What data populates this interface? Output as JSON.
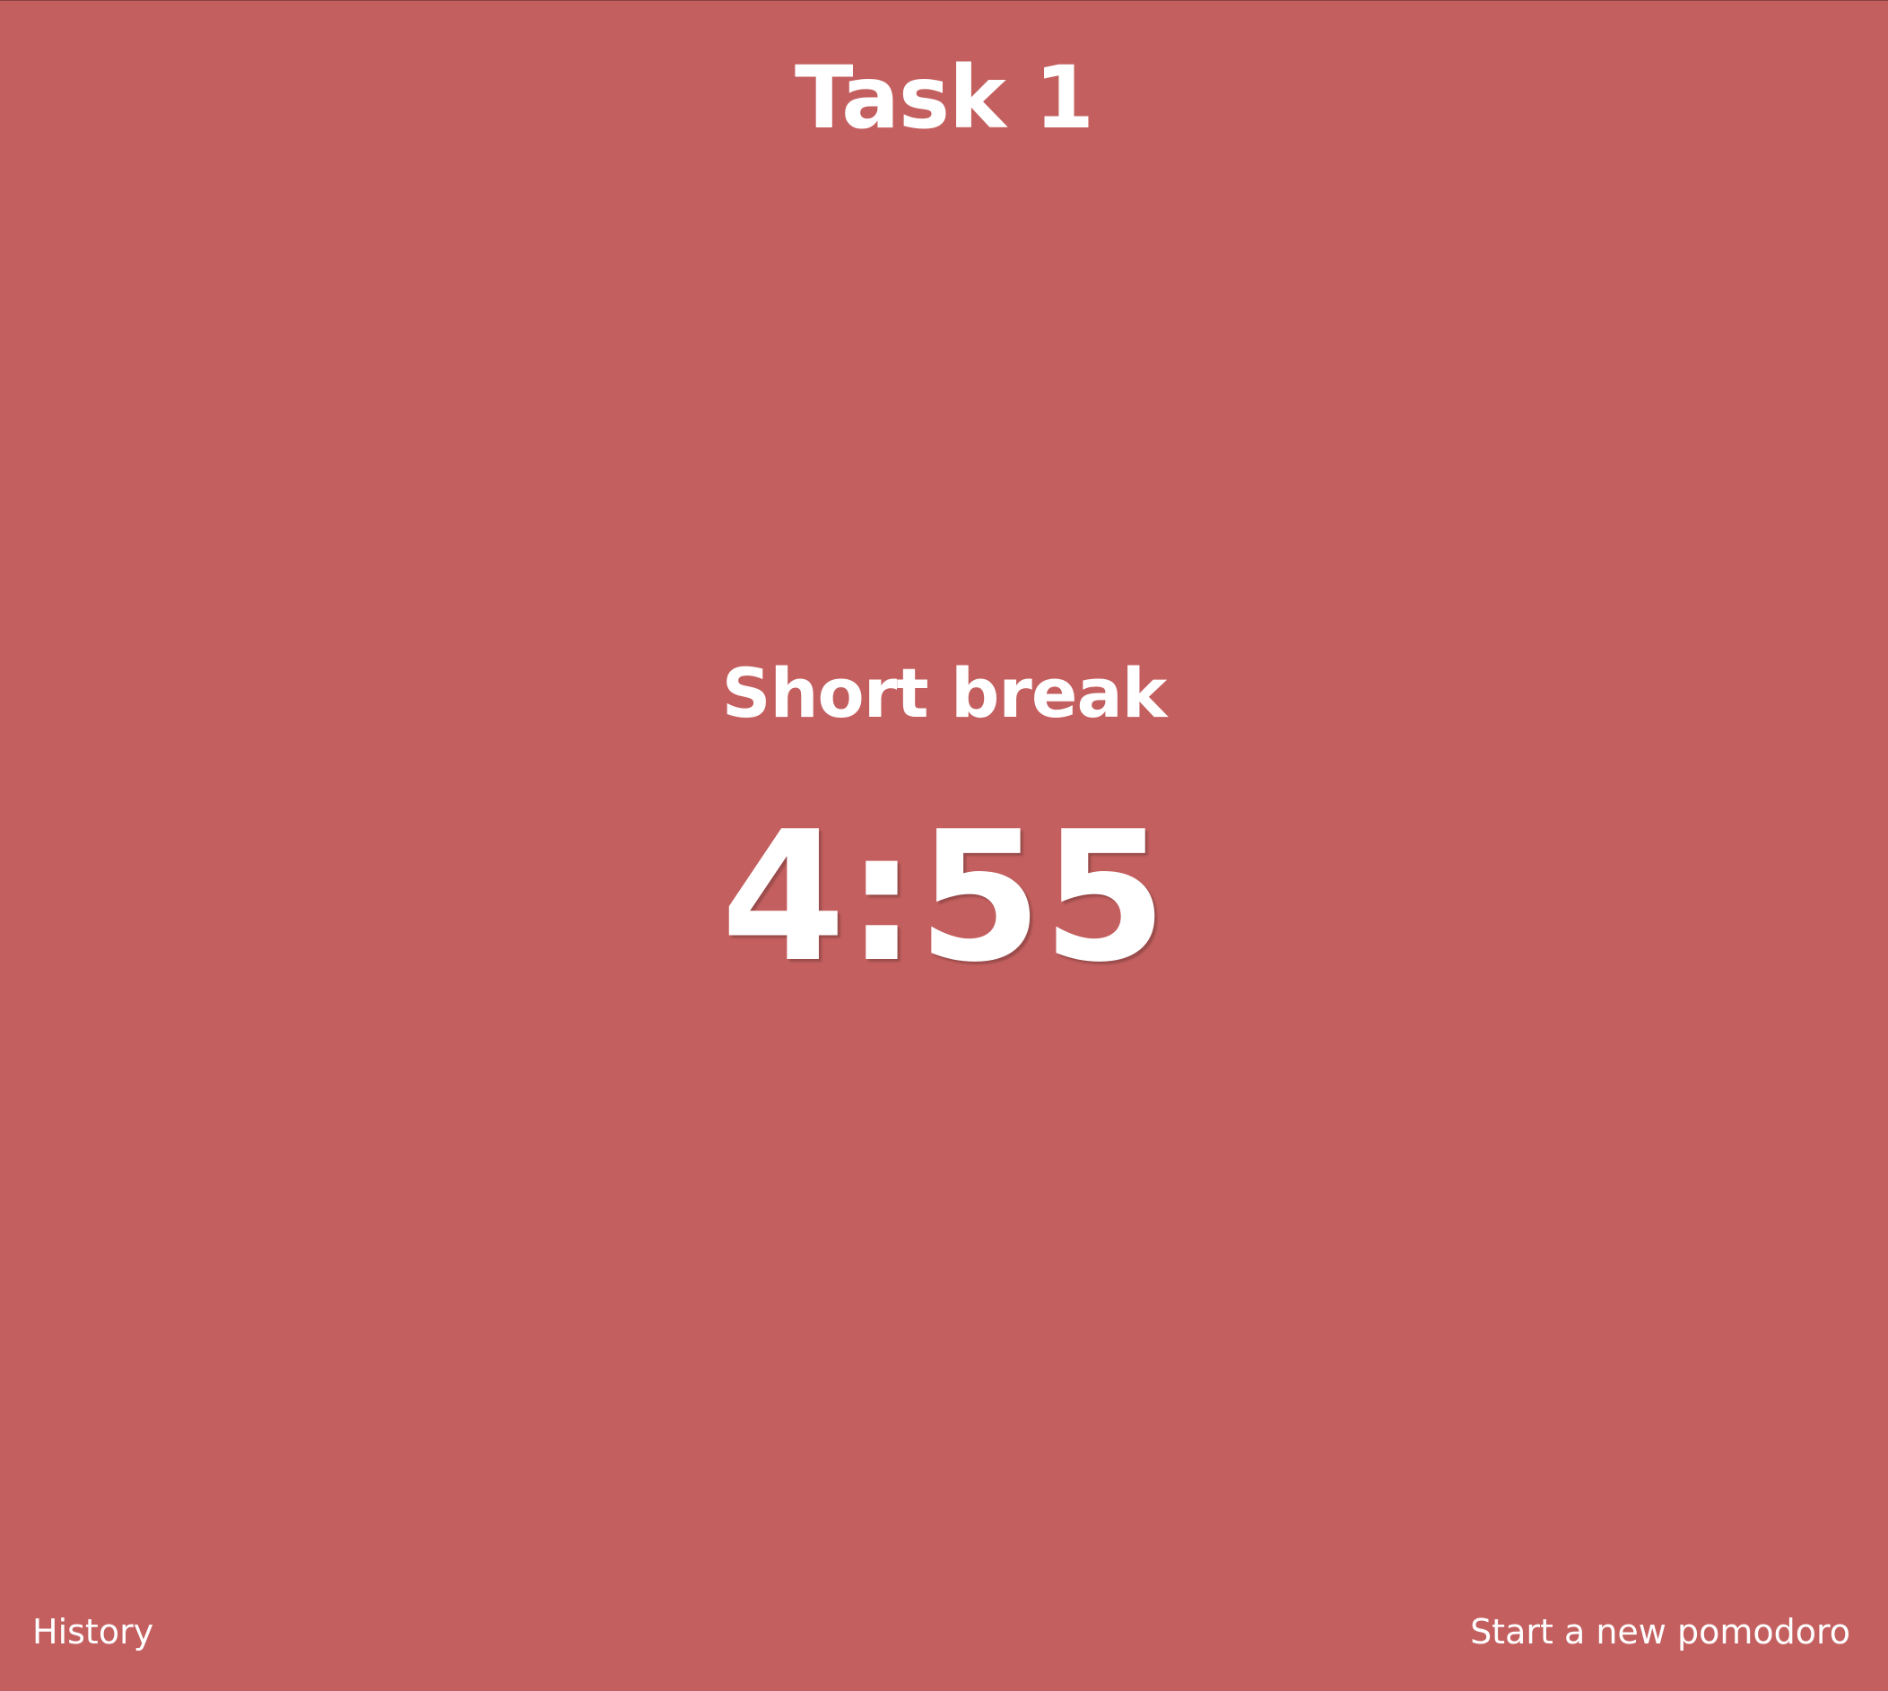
{
  "task": {
    "title": "Task 1"
  },
  "timer": {
    "phase": "Short break",
    "remaining": "4:55"
  },
  "footer": {
    "history_label": "History",
    "new_pomodoro_label": "Start a new pomodoro"
  },
  "colors": {
    "background": "#c45f5f",
    "text": "#ffffff"
  }
}
